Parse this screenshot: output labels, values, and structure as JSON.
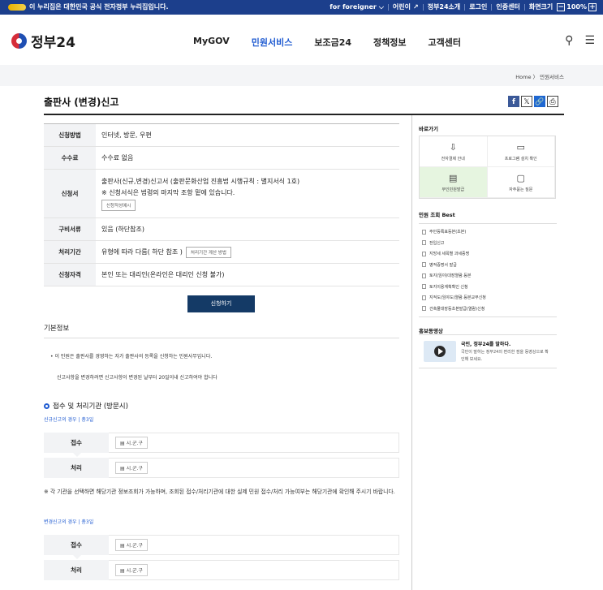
{
  "topbar": {
    "gov_notice": "이 누리집은 대한민국 공식 전자정부 누리집입니다.",
    "util": [
      "for foreigner",
      "어린이",
      "정부24소개",
      "로그인",
      "인증센터",
      "화면크기"
    ],
    "zoom": "100%",
    "minus": "−",
    "plus": "+"
  },
  "header": {
    "logo": "정부24",
    "nav": [
      "MyGOV",
      "민원서비스",
      "보조금24",
      "정책정보",
      "고객센터"
    ],
    "search_icon": "⚲",
    "menu_icon": "☰"
  },
  "breadcrumb": "Home 〉 민원서비스",
  "page_title": "출판사 (변경)신고",
  "share": {
    "fb": "f",
    "x": "𝕏",
    "link": "🔗",
    "print": "⎙"
  },
  "info_rows": [
    {
      "label": "신청방법",
      "value": "인터넷, 방문, 우편"
    },
    {
      "label": "수수료",
      "value": "수수료 없음"
    },
    {
      "label": "신청서",
      "value": "출판사(신규,변경)신고서 (출판문화산업 진흥법 시행규칙 : 별지서식 1호)",
      "value2": "※ 신청서식은 법령의 마지막 조항 밑에 있습니다.",
      "btn": "신청작성예시"
    },
    {
      "label": "구비서류",
      "value": "있음 (하단참조)"
    },
    {
      "label": "처리기간",
      "value": "유형에 따라 다름( 하단 참조 )",
      "btn": "처리기간 계산 방법"
    },
    {
      "label": "신청자격",
      "value": "본인 또는 대리인(온라인은 대리인 신청 불가)"
    }
  ],
  "apply_label": "신청하기",
  "basic_info": {
    "heading": "기본정보",
    "note1": "• 이 민원은 출판사를 경영하는 자가 출판사의 등록을 신청하는 민원사무입니다.",
    "note2": "신고사항을 변경하려면 신고사항이 변경된 날부터 20일이내 신고하여야 합니다"
  },
  "process": {
    "heading": "접수 및 처리기관 (방문시)",
    "case1": "신규신고의 경우 | 총3일",
    "case2": "변경신고의 경우 | 총3일",
    "receive_label": "접수",
    "handle_label": "처리",
    "org": "시.군.구",
    "caution": "※ 각 기관을 선택하면 해당기관 정보조회가 가능하며, 조회된 접수/처리기관에 대한 실제 민원 접수/처리 가능여부는 해당기관에 확인해 주시기 바랍니다."
  },
  "sidebar": {
    "quick_heading": "바로가기",
    "quick": [
      {
        "label": "전자결제 안내",
        "icon": "⇩"
      },
      {
        "label": "프로그램 설치 확인",
        "icon": "▭"
      },
      {
        "label": "무인민원발급",
        "icon": "▤"
      },
      {
        "label": "자주묻는 질문",
        "icon": "▢"
      }
    ],
    "best_heading": "민원 조회 Best",
    "best": [
      "주민등록표등본(초본)",
      "전입신고",
      "지방세 세목별 과세증명",
      "병적증명서 발급",
      "토지(임야)대장열람.등본",
      "토지이용계획확인 신청",
      "지적도(임야도)열람.등본교부신청",
      "건축물대장등초본발급(열람)신청"
    ],
    "video_heading": "홍보동영상",
    "video_title": "국민, 정부24를 말하다.",
    "video_desc": "국민이 말하는 정부24의 편리한 점을 동영상으로 확인해 보세요."
  }
}
